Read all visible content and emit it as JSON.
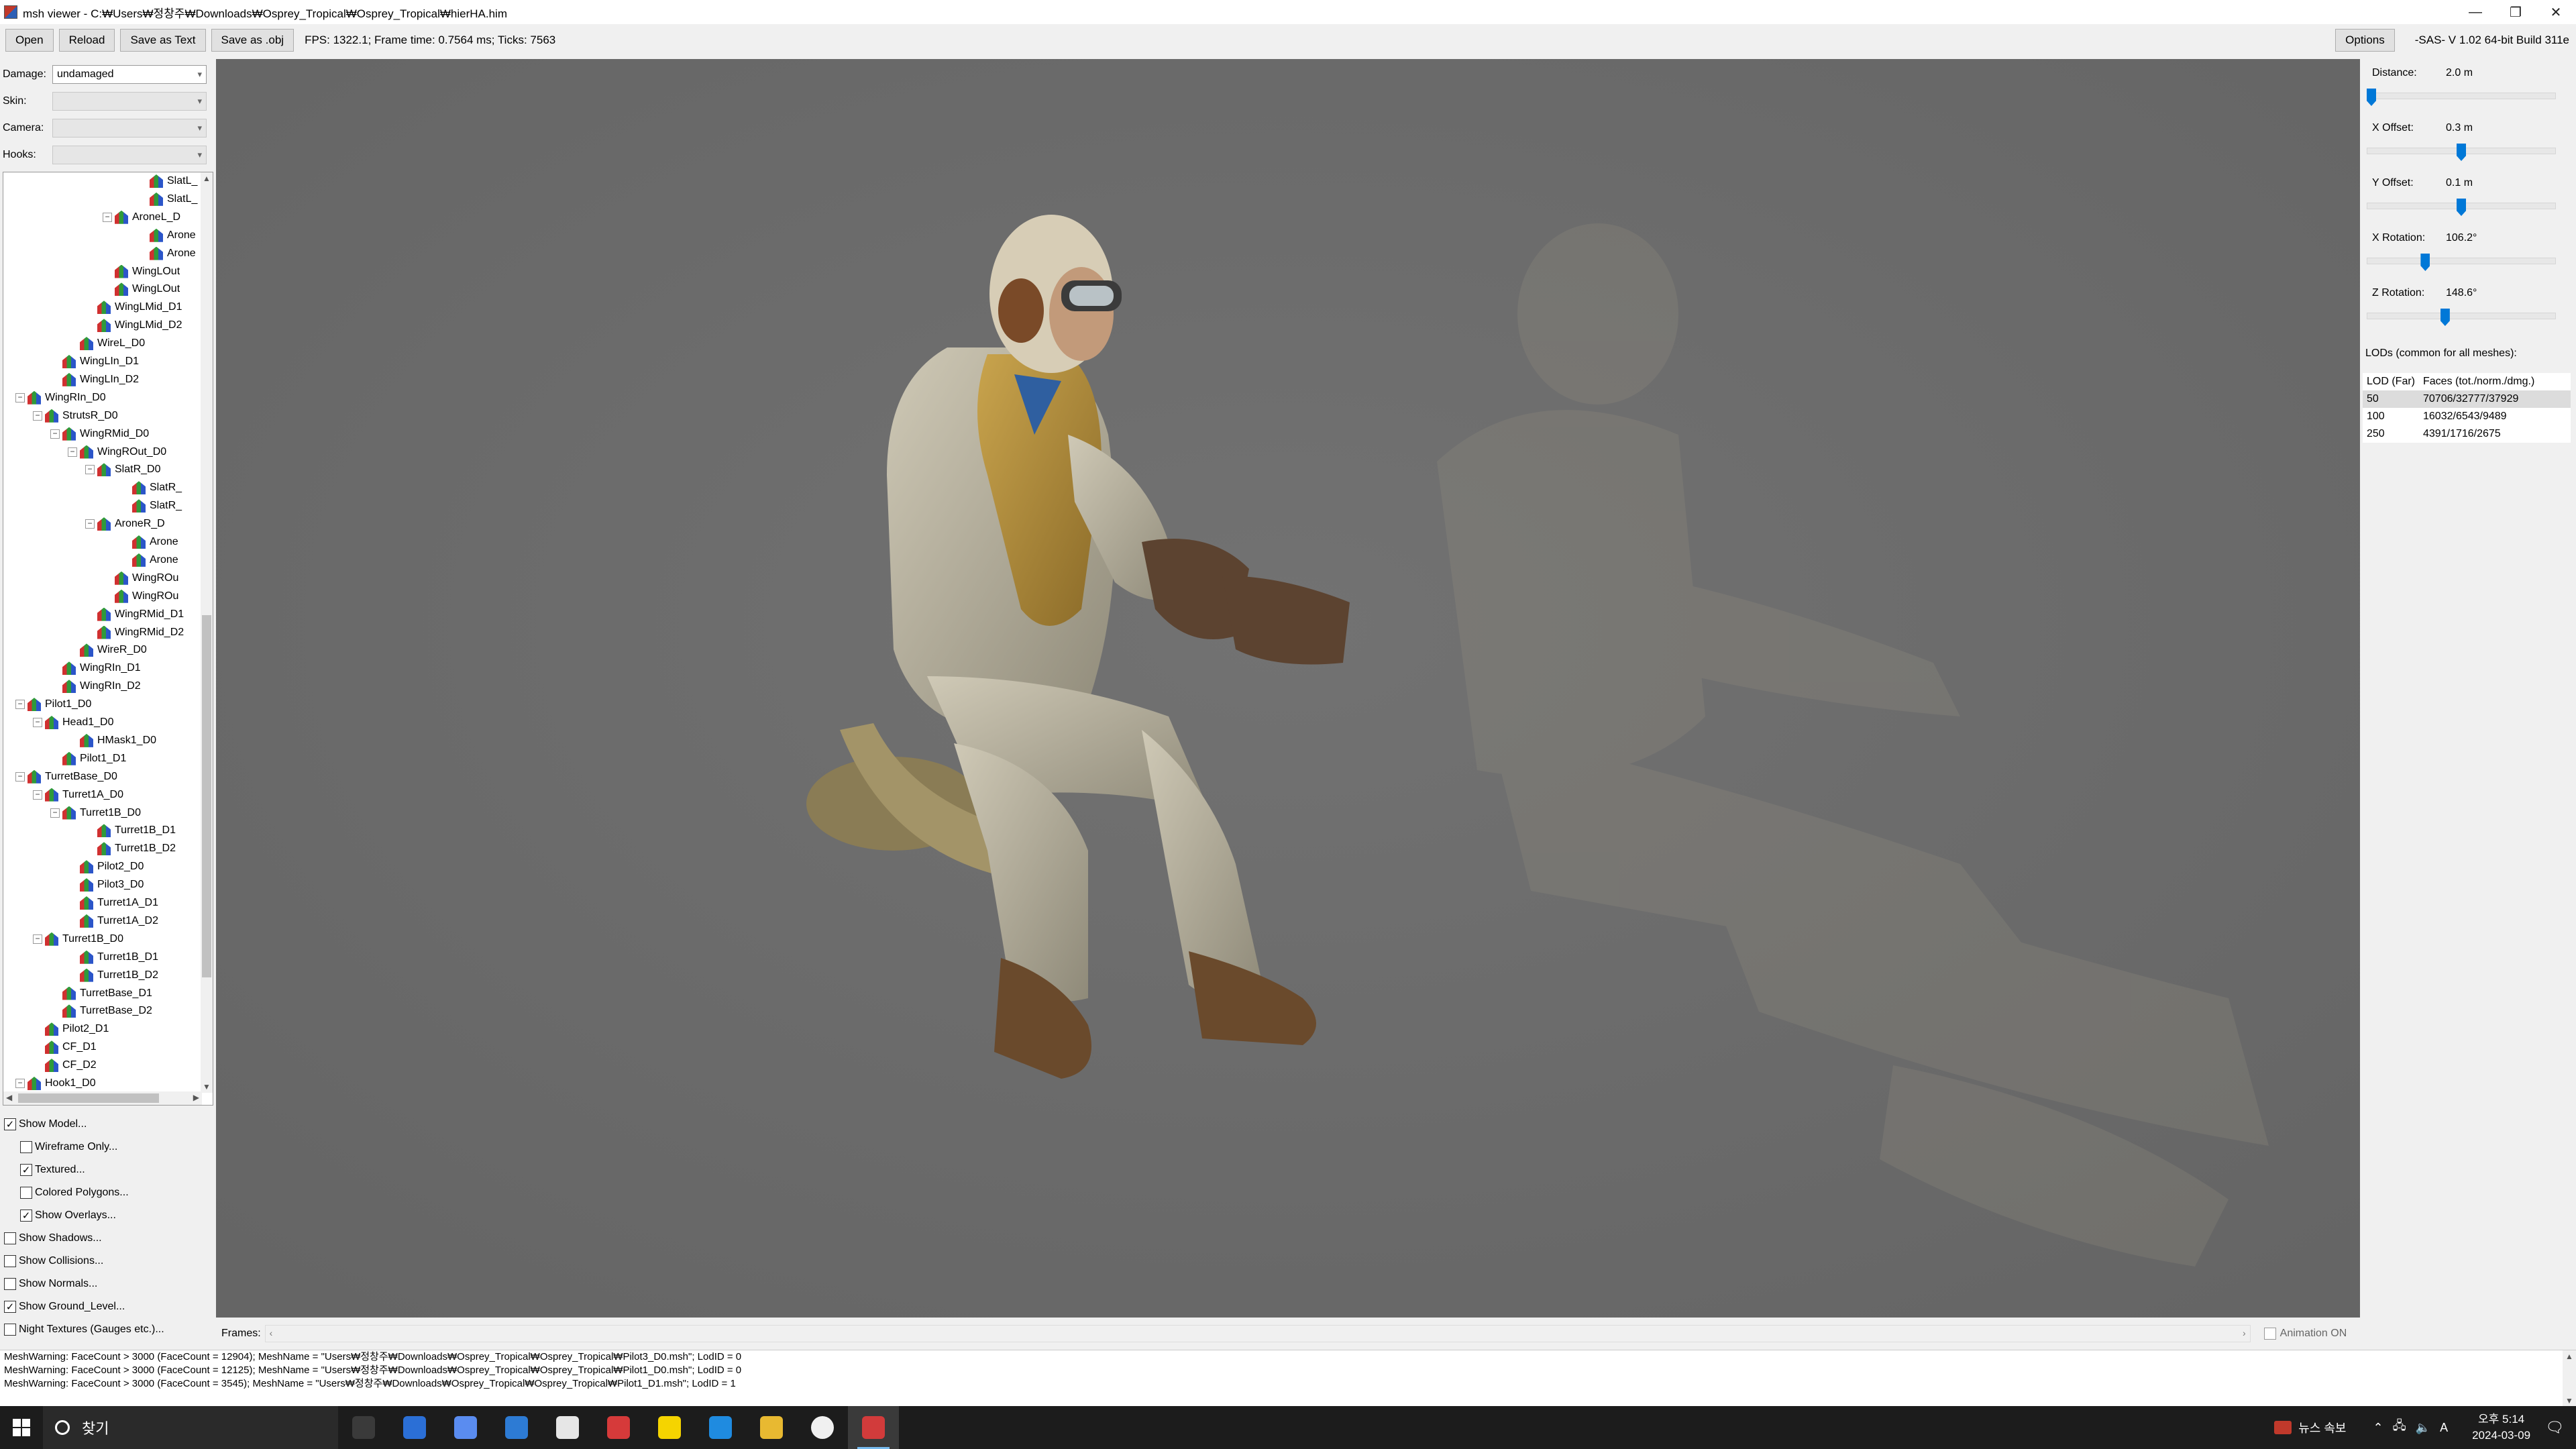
{
  "window": {
    "title": "msh viewer - C:₩Users₩정창주₩Downloads₩Osprey_Tropical₩Osprey_Tropical₩hierHA.him",
    "icon": "app-icon",
    "controls": [
      "minimize-icon",
      "maximize-icon",
      "close-icon"
    ]
  },
  "toolbar": {
    "open": "Open",
    "reload": "Reload",
    "save_text": "Save as Text",
    "save_obj": "Save as .obj",
    "fps": "FPS: 1322.1; Frame time: 0.7564 ms; Ticks: 7563",
    "options": "Options",
    "version": "-SAS- V 1.02  64-bit  Build 311e"
  },
  "left": {
    "damage_label": "Damage:",
    "damage_value": "undamaged",
    "skin_label": "Skin:",
    "skin_value": "",
    "camera_label": "Camera:",
    "camera_value": "",
    "hooks_label": "Hooks:",
    "hooks_value": ""
  },
  "tree": [
    {
      "label": "SlatL_",
      "level": 8,
      "exp": ""
    },
    {
      "label": "SlatL_",
      "level": 8,
      "exp": ""
    },
    {
      "label": "AroneL_D",
      "level": 6,
      "exp": "−"
    },
    {
      "label": "Arone",
      "level": 8,
      "exp": ""
    },
    {
      "label": "Arone",
      "level": 8,
      "exp": ""
    },
    {
      "label": "WingLOut",
      "level": 6,
      "exp": ""
    },
    {
      "label": "WingLOut",
      "level": 6,
      "exp": ""
    },
    {
      "label": "WingLMid_D1",
      "level": 5,
      "exp": ""
    },
    {
      "label": "WingLMid_D2",
      "level": 5,
      "exp": ""
    },
    {
      "label": "WireL_D0",
      "level": 4,
      "exp": ""
    },
    {
      "label": "WingLIn_D1",
      "level": 3,
      "exp": ""
    },
    {
      "label": "WingLIn_D2",
      "level": 3,
      "exp": ""
    },
    {
      "label": "WingRIn_D0",
      "level": 1,
      "exp": "−"
    },
    {
      "label": "StrutsR_D0",
      "level": 2,
      "exp": "−"
    },
    {
      "label": "WingRMid_D0",
      "level": 3,
      "exp": "−"
    },
    {
      "label": "WingROut_D0",
      "level": 4,
      "exp": "−"
    },
    {
      "label": "SlatR_D0",
      "level": 5,
      "exp": "−"
    },
    {
      "label": "SlatR_",
      "level": 7,
      "exp": ""
    },
    {
      "label": "SlatR_",
      "level": 7,
      "exp": ""
    },
    {
      "label": "AroneR_D",
      "level": 5,
      "exp": "−"
    },
    {
      "label": "Arone",
      "level": 7,
      "exp": ""
    },
    {
      "label": "Arone",
      "level": 7,
      "exp": ""
    },
    {
      "label": "WingROu",
      "level": 6,
      "exp": ""
    },
    {
      "label": "WingROu",
      "level": 6,
      "exp": ""
    },
    {
      "label": "WingRMid_D1",
      "level": 5,
      "exp": ""
    },
    {
      "label": "WingRMid_D2",
      "level": 5,
      "exp": ""
    },
    {
      "label": "WireR_D0",
      "level": 4,
      "exp": ""
    },
    {
      "label": "WingRIn_D1",
      "level": 3,
      "exp": ""
    },
    {
      "label": "WingRIn_D2",
      "level": 3,
      "exp": ""
    },
    {
      "label": "Pilot1_D0",
      "level": 1,
      "exp": "−"
    },
    {
      "label": "Head1_D0",
      "level": 2,
      "exp": "−"
    },
    {
      "label": "HMask1_D0",
      "level": 4,
      "exp": ""
    },
    {
      "label": "Pilot1_D1",
      "level": 3,
      "exp": ""
    },
    {
      "label": "TurretBase_D0",
      "level": 1,
      "exp": "−"
    },
    {
      "label": "Turret1A_D0",
      "level": 2,
      "exp": "−"
    },
    {
      "label": "Turret1B_D0",
      "level": 3,
      "exp": "−"
    },
    {
      "label": "Turret1B_D1",
      "level": 5,
      "exp": ""
    },
    {
      "label": "Turret1B_D2",
      "level": 5,
      "exp": ""
    },
    {
      "label": "Pilot2_D0",
      "level": 4,
      "exp": ""
    },
    {
      "label": "Pilot3_D0",
      "level": 4,
      "exp": ""
    },
    {
      "label": "Turret1A_D1",
      "level": 4,
      "exp": ""
    },
    {
      "label": "Turret1A_D2",
      "level": 4,
      "exp": ""
    },
    {
      "label": "Turret1B_D0",
      "level": 2,
      "exp": "−"
    },
    {
      "label": "Turret1B_D1",
      "level": 4,
      "exp": ""
    },
    {
      "label": "Turret1B_D2",
      "level": 4,
      "exp": ""
    },
    {
      "label": "TurretBase_D1",
      "level": 3,
      "exp": ""
    },
    {
      "label": "TurretBase_D2",
      "level": 3,
      "exp": ""
    },
    {
      "label": "Pilot2_D1",
      "level": 2,
      "exp": ""
    },
    {
      "label": "CF_D1",
      "level": 2,
      "exp": ""
    },
    {
      "label": "CF_D2",
      "level": 2,
      "exp": ""
    },
    {
      "label": "Hook1_D0",
      "level": 1,
      "exp": "−"
    }
  ],
  "checkboxes": [
    {
      "label": "Show Model...",
      "checked": true,
      "indent": 0
    },
    {
      "label": "Wireframe Only...",
      "checked": false,
      "indent": 1
    },
    {
      "label": "Textured...",
      "checked": true,
      "indent": 1
    },
    {
      "label": "Colored Polygons...",
      "checked": false,
      "indent": 1
    },
    {
      "label": "Show Overlays...",
      "checked": true,
      "indent": 1
    },
    {
      "label": "Show Shadows...",
      "checked": false,
      "indent": 0
    },
    {
      "label": "Show Collisions...",
      "checked": false,
      "indent": 0
    },
    {
      "label": "Show Normals...",
      "checked": false,
      "indent": 0
    },
    {
      "label": "Show Ground_Level...",
      "checked": true,
      "indent": 0
    },
    {
      "label": "Night Textures (Gauges etc.)...",
      "checked": false,
      "indent": 0
    }
  ],
  "frames": {
    "label": "Frames:",
    "animation": "Animation ON"
  },
  "right": {
    "sliders": [
      {
        "name": "Distance:",
        "value": "2.0 m",
        "fraction": 0.0
      },
      {
        "name": "X Offset:",
        "value": "0.3 m",
        "fraction": 0.5
      },
      {
        "name": "Y Offset:",
        "value": "0.1 m",
        "fraction": 0.5
      },
      {
        "name": "X Rotation:",
        "value": "106.2°",
        "fraction": 0.3
      },
      {
        "name": "Z Rotation:",
        "value": "148.6°",
        "fraction": 0.41
      }
    ],
    "lods_title": "LODs (common for all meshes):",
    "lod_headers": [
      "LOD (Far)",
      "Faces (tot./norm./dmg.)"
    ],
    "lods": [
      {
        "lod": "50",
        "faces": "70706/32777/37929",
        "selected": true
      },
      {
        "lod": "100",
        "faces": "16032/6543/9489",
        "selected": false
      },
      {
        "lod": "250",
        "faces": "4391/1716/2675",
        "selected": false
      }
    ]
  },
  "log": [
    "MeshWarning: FaceCount > 3000 (FaceCount = 12904); MeshName = \"Users₩정창주₩Downloads₩Osprey_Tropical₩Osprey_Tropical₩Pilot3_D0.msh\"; LodID = 0",
    "MeshWarning: FaceCount > 3000 (FaceCount = 12125); MeshName = \"Users₩정창주₩Downloads₩Osprey_Tropical₩Osprey_Tropical₩Pilot1_D0.msh\"; LodID = 0",
    "MeshWarning: FaceCount > 3000 (FaceCount = 3545); MeshName = \"Users₩정창주₩Downloads₩Osprey_Tropical₩Osprey_Tropical₩Pilot1_D1.msh\"; LodID = 1"
  ],
  "taskbar": {
    "search": "찾기",
    "news": "뉴스 속보",
    "time": "오후 5:14",
    "date": "2024-03-09",
    "apps": [
      "task-view-icon",
      "store-icon",
      "copilot-icon",
      "mail-icon",
      "game-icon",
      "security-icon",
      "kakaotalk-icon",
      "edge-icon",
      "file-explorer-icon",
      "chrome-icon",
      "msh-viewer-icon"
    ]
  },
  "colors": {
    "viewport_bg": "#6b6b6b",
    "accent": "#0078d7",
    "taskbar_bg": "#1c1c1c"
  }
}
